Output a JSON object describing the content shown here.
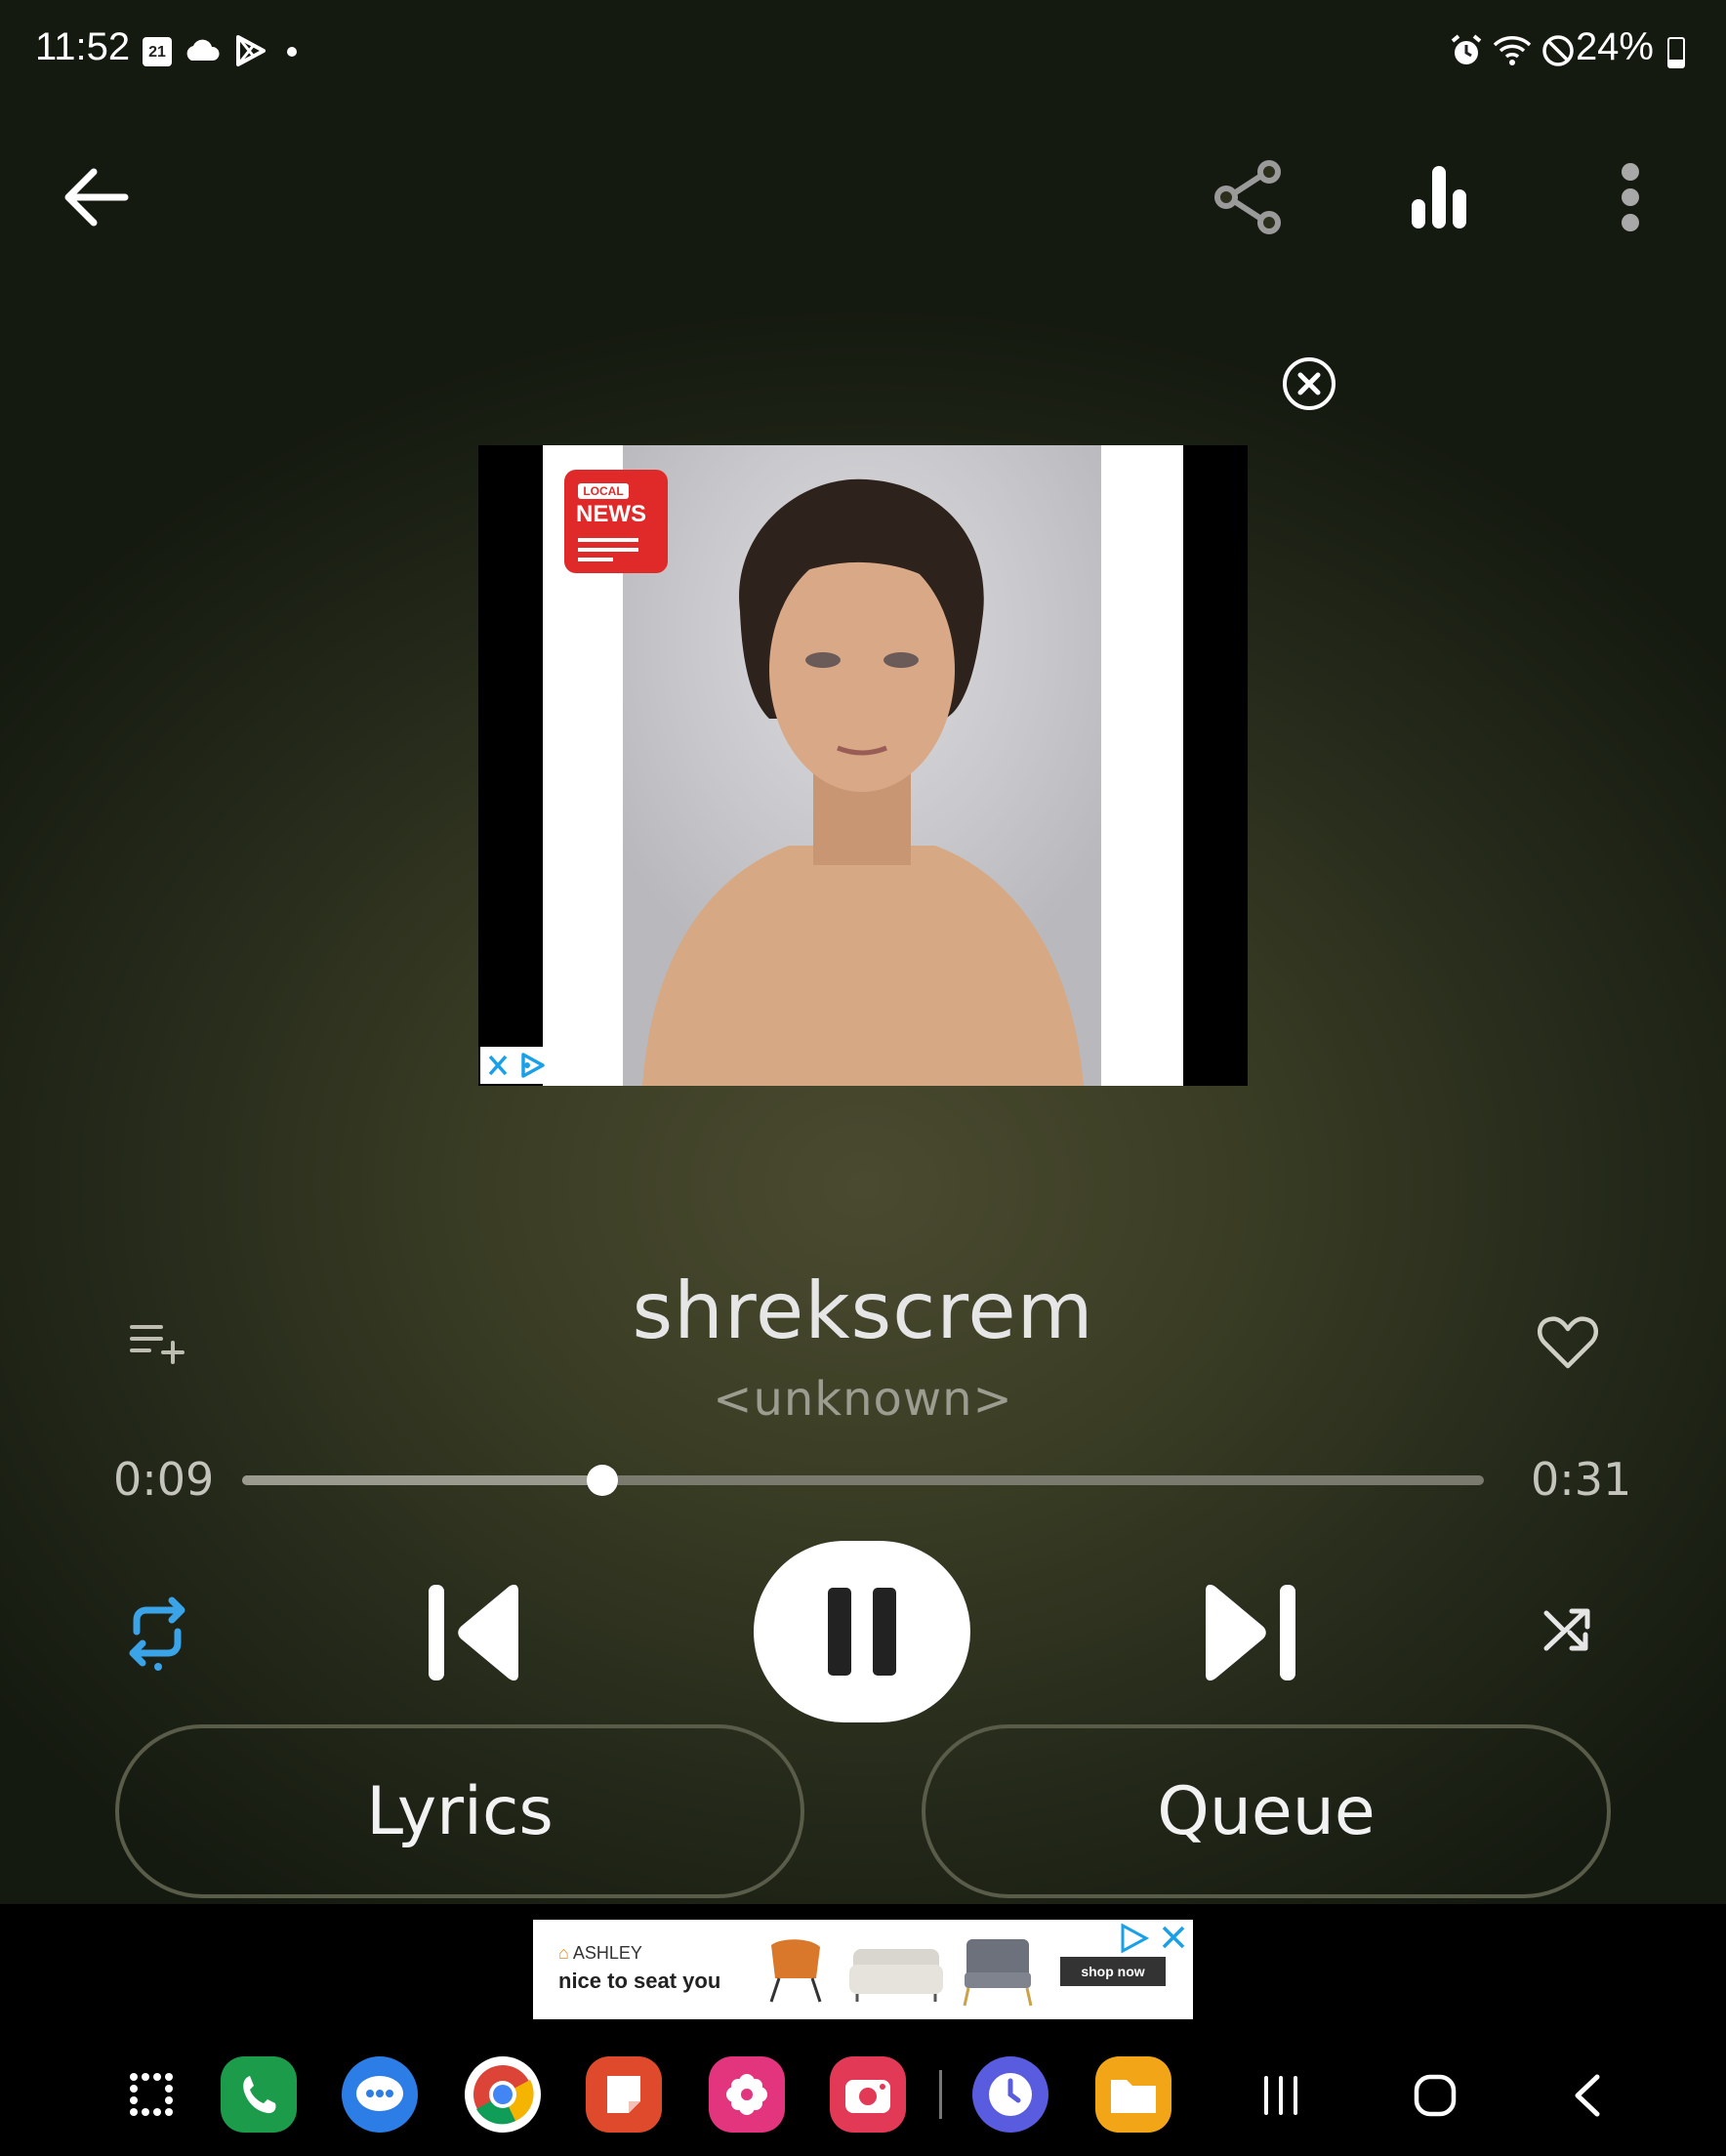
{
  "status_bar": {
    "time": "11:52",
    "calendar_day": "21",
    "battery": "24%",
    "icons": [
      "calendar-icon",
      "cloud-icon",
      "play-store-icon",
      "notification-dot",
      "alarm-icon",
      "wifi-icon",
      "do-not-disturb-icon",
      "battery-icon"
    ]
  },
  "top_bar": {
    "actions": [
      "back-icon",
      "share-icon",
      "equalizer-icon",
      "more-icon"
    ]
  },
  "ad": {
    "badge_small": "LOCAL",
    "badge_big": "NEWS",
    "icons": [
      "ad-close-icon",
      "ad-choices-icon"
    ]
  },
  "song": {
    "title": "shrekscrem",
    "artist": "<unknown>",
    "elapsed": "0:09",
    "duration": "0:31",
    "progress_fraction": 0.29
  },
  "controls": {
    "repeat": "repeat-icon",
    "previous": "previous-icon",
    "play_pause": "pause-icon",
    "next": "next-icon",
    "shuffle": "shuffle-icon",
    "add_to_playlist": "add-to-playlist-icon",
    "favorite": "heart-icon",
    "repeat_color": "#3ba3e8"
  },
  "buttons": {
    "lyrics": "Lyrics",
    "queue": "Queue"
  },
  "banner_ad": {
    "brand": "ASHLEY",
    "tagline": "nice to seat you",
    "cta": "shop now"
  },
  "dock": {
    "apps": [
      "app-drawer-icon",
      "phone-app-icon",
      "messages-app-icon",
      "chrome-app-icon",
      "notes-app-icon",
      "gallery-app-icon",
      "camera-app-icon",
      "clock-app-icon",
      "files-app-icon"
    ],
    "nav": [
      "recents-button",
      "home-button",
      "back-nav-button"
    ]
  }
}
